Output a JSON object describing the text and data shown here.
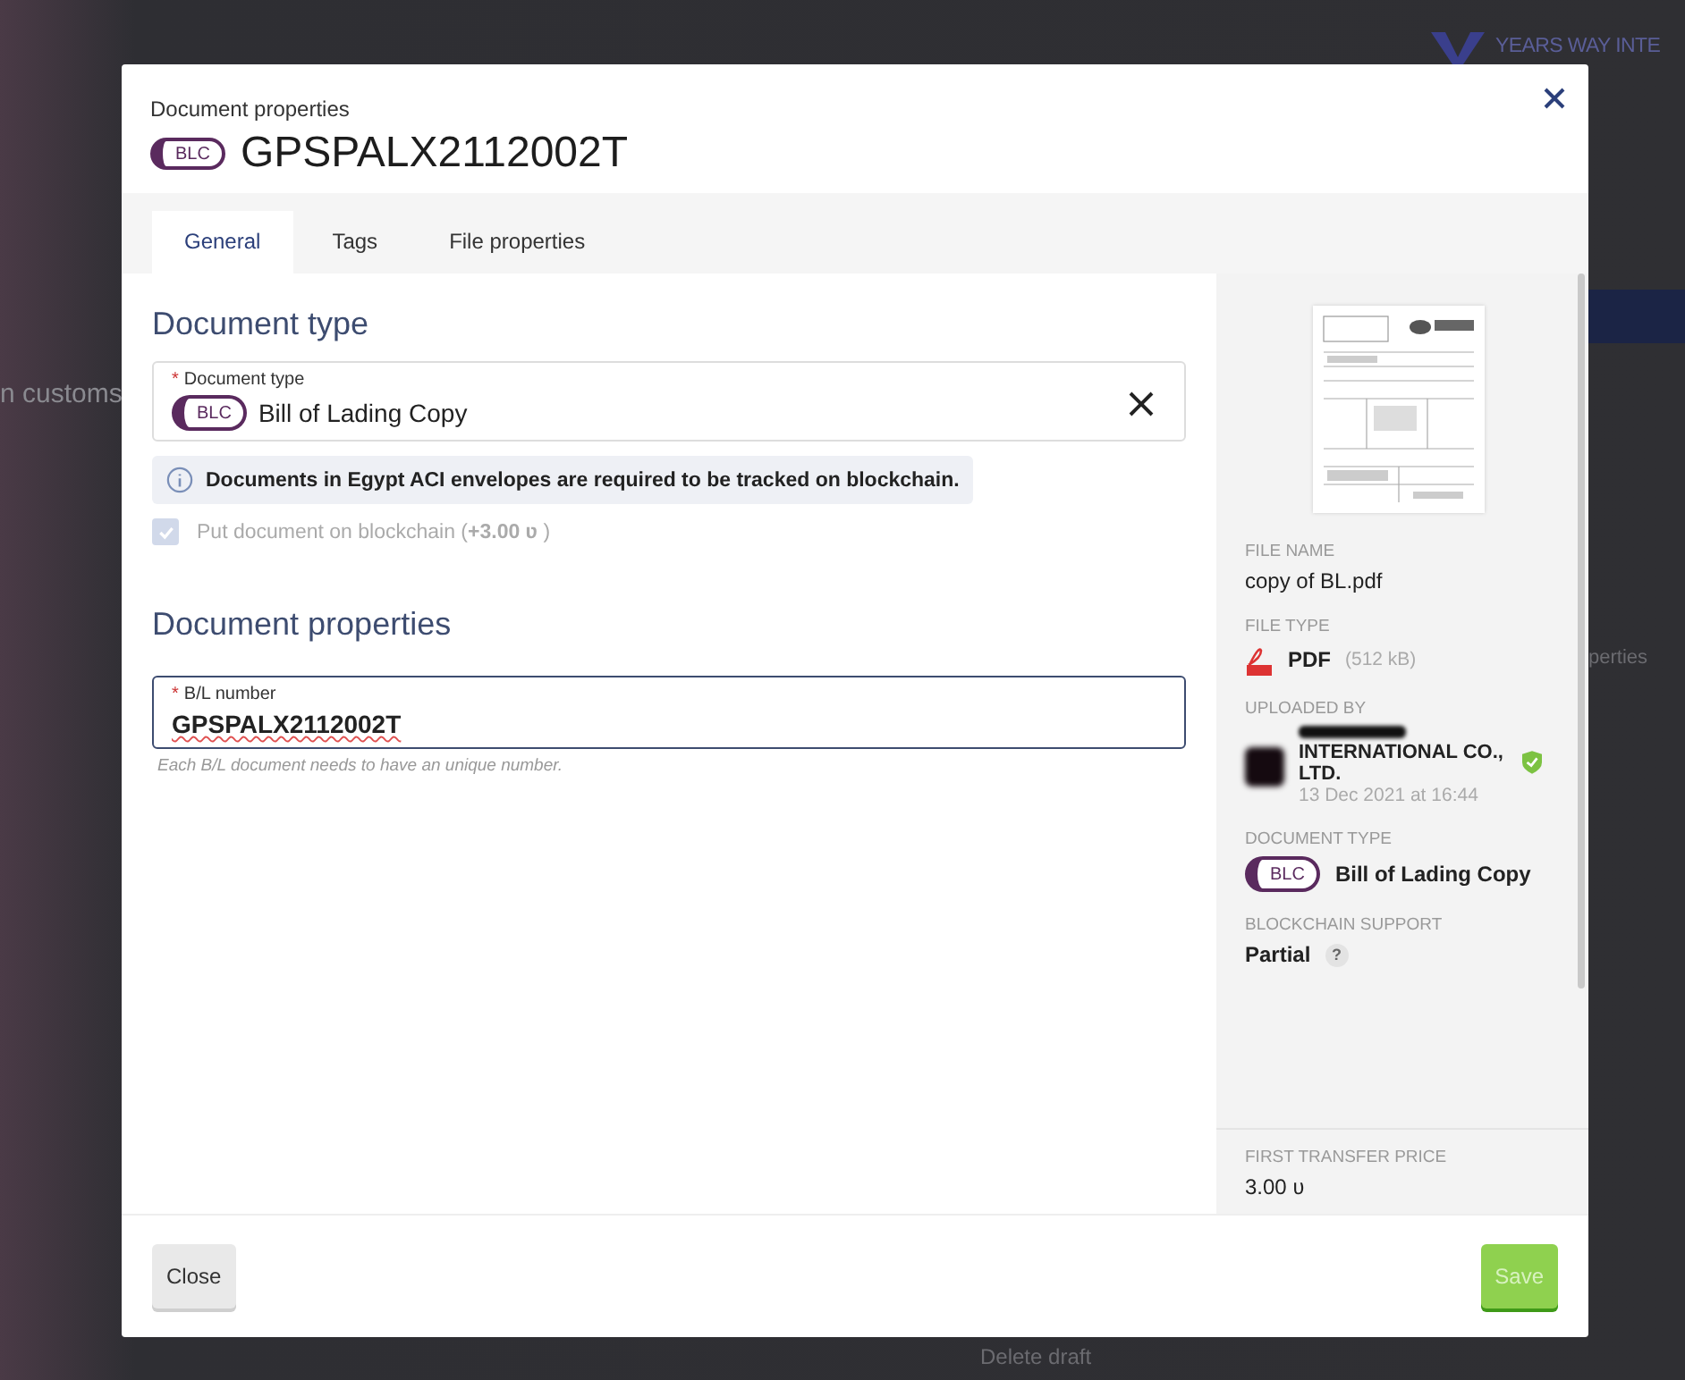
{
  "background": {
    "brand": "YEARS WAY INTE",
    "fragments": [
      "n customs",
      "perties",
      "Delete draft"
    ]
  },
  "dialog": {
    "subtitle": "Document properties",
    "type_badge": "BLC",
    "title": "GPSPALX2112002T"
  },
  "tabs": [
    {
      "label": "General",
      "selected": true
    },
    {
      "label": "Tags",
      "selected": false
    },
    {
      "label": "File properties",
      "selected": false
    }
  ],
  "document_type_section": {
    "heading": "Document type",
    "field": {
      "label": "Document type",
      "required_mark": "*",
      "badge": "BLC",
      "value": "Bill of Lading Copy"
    },
    "info": "Documents in Egypt ACI envelopes are required to be tracked on blockchain.",
    "checkbox": {
      "label": "Put document on blockchain (**+3.00 ʋ** )",
      "checked": true,
      "disabled": true
    }
  },
  "document_properties_section": {
    "heading": "Document properties",
    "field": {
      "label": "B/L number",
      "required_mark": "*",
      "value": "GPSPALX2112002T",
      "hint": "Each B/L document needs to have an unique number."
    }
  },
  "side_panel": {
    "details": [
      {
        "kind": "text",
        "label": "FILE NAME",
        "value": "copy of BL.pdf"
      },
      {
        "kind": "file",
        "label": "FILE TYPE",
        "value": "PDF",
        "note": "(512 kB)"
      },
      {
        "kind": "user",
        "label": "UPLOADED BY",
        "value": "INTERNATIONAL CO., LTD.",
        "time": "13 Dec 2021 at 16:44",
        "verified": true
      },
      {
        "kind": "doctype",
        "label": "DOCUMENT TYPE",
        "badge": "BLC",
        "value": "Bill of Lading Copy"
      },
      {
        "kind": "help",
        "label": "BLOCKCHAIN SUPPORT",
        "value": "Partial",
        "help": "?"
      }
    ],
    "price": {
      "label": "FIRST TRANSFER PRICE",
      "value": "3.00 ʋ"
    }
  },
  "buttons": [
    {
      "label": "Close",
      "kind": "secondary",
      "disabled": false
    },
    {
      "label": "Save",
      "kind": "primary",
      "disabled": true
    }
  ]
}
